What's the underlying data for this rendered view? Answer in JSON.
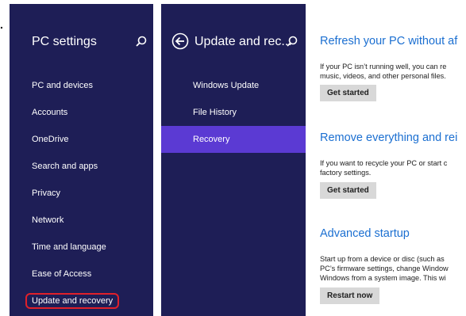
{
  "pc_settings": {
    "title": "PC settings",
    "items": [
      {
        "label": "PC and devices"
      },
      {
        "label": "Accounts"
      },
      {
        "label": "OneDrive"
      },
      {
        "label": "Search and apps"
      },
      {
        "label": "Privacy"
      },
      {
        "label": "Network"
      },
      {
        "label": "Time and language"
      },
      {
        "label": "Ease of Access"
      },
      {
        "label": "Update and recovery"
      }
    ],
    "selected_index": 8
  },
  "update_pane": {
    "title": "Update and rec...",
    "items": [
      {
        "label": "Windows Update"
      },
      {
        "label": "File History"
      },
      {
        "label": "Recovery"
      }
    ],
    "active_index": 2
  },
  "content": {
    "refresh": {
      "title": "Refresh your PC without af",
      "desc": "If your PC isn’t running well, you can re\nmusic, videos, and other personal files.",
      "button": "Get started"
    },
    "remove": {
      "title": "Remove everything and rei",
      "desc": "If you want to recycle your PC or start c\nfactory settings.",
      "button": "Get started"
    },
    "advanced": {
      "title": "Advanced startup",
      "desc": "Start up from a device or disc (such as\nPC’s firmware settings, change Window\nWindows from a system image. This wi",
      "button": "Restart now"
    }
  },
  "colors": {
    "pane_bg": "#1e1e56",
    "active_item": "#5b3ad3",
    "accent_text": "#1b6fd1",
    "highlight_border": "#e0202a"
  }
}
